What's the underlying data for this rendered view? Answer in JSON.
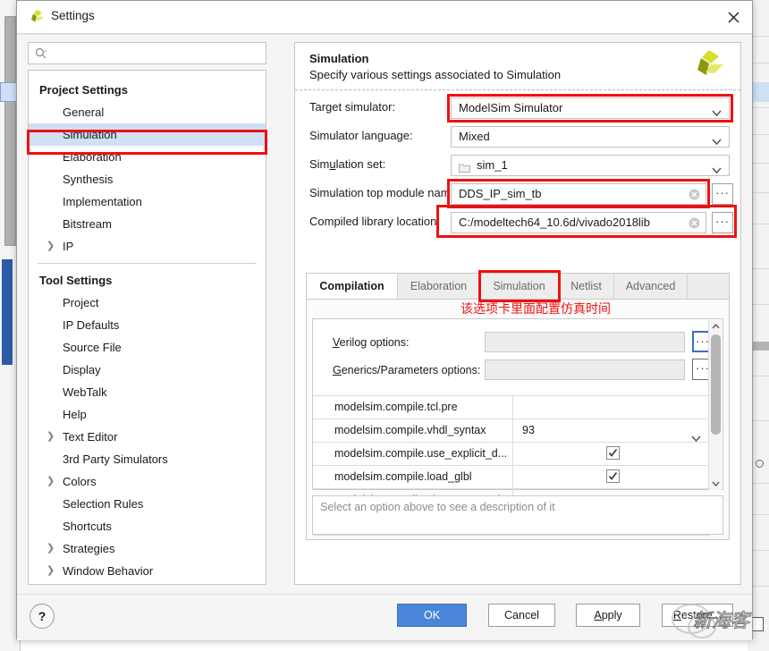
{
  "window": {
    "title": "Settings",
    "logo_icon": "vivado-logo-icon",
    "close_icon": "close-icon"
  },
  "sidebar": {
    "search": {
      "placeholder": "",
      "value": "",
      "icon": "search-icon"
    },
    "groups": [
      {
        "title": "Project Settings",
        "items": [
          {
            "label": "General",
            "expandable": false,
            "selected": false
          },
          {
            "label": "Simulation",
            "expandable": false,
            "selected": true
          },
          {
            "label": "Elaboration",
            "expandable": false,
            "selected": false
          },
          {
            "label": "Synthesis",
            "expandable": false,
            "selected": false
          },
          {
            "label": "Implementation",
            "expandable": false,
            "selected": false
          },
          {
            "label": "Bitstream",
            "expandable": false,
            "selected": false
          },
          {
            "label": "IP",
            "expandable": true,
            "selected": false
          }
        ]
      },
      {
        "title": "Tool Settings",
        "items": [
          {
            "label": "Project",
            "expandable": false,
            "selected": false
          },
          {
            "label": "IP Defaults",
            "expandable": false,
            "selected": false
          },
          {
            "label": "Source File",
            "expandable": false,
            "selected": false
          },
          {
            "label": "Display",
            "expandable": false,
            "selected": false
          },
          {
            "label": "WebTalk",
            "expandable": false,
            "selected": false
          },
          {
            "label": "Help",
            "expandable": false,
            "selected": false
          },
          {
            "label": "Text Editor",
            "expandable": true,
            "selected": false
          },
          {
            "label": "3rd Party Simulators",
            "expandable": false,
            "selected": false
          },
          {
            "label": "Colors",
            "expandable": true,
            "selected": false
          },
          {
            "label": "Selection Rules",
            "expandable": false,
            "selected": false
          },
          {
            "label": "Shortcuts",
            "expandable": false,
            "selected": false
          },
          {
            "label": "Strategies",
            "expandable": true,
            "selected": false
          },
          {
            "label": "Window Behavior",
            "expandable": true,
            "selected": false
          }
        ]
      }
    ]
  },
  "content": {
    "heading": "Simulation",
    "subheading": "Specify various settings associated to Simulation",
    "fields": [
      {
        "label": "Target simulator:",
        "value": "ModelSim Simulator",
        "kind": "combo",
        "highlighted": true
      },
      {
        "label": "Simulator language:",
        "value": "Mixed",
        "kind": "combo",
        "highlighted": false
      },
      {
        "label": "Simulation set:",
        "value": "sim_1",
        "kind": "combo-folder",
        "highlighted": false
      },
      {
        "label": "Simulation top module name:",
        "value": "DDS_IP_sim_tb",
        "kind": "text",
        "highlighted": true
      },
      {
        "label": "Compiled library location:",
        "value": "C:/modeltech64_10.6d/vivado2018lib",
        "kind": "text",
        "highlighted": true
      }
    ],
    "dots_label": "···"
  },
  "tabs": {
    "items": [
      {
        "label": "Compilation",
        "active": true,
        "highlighted": false
      },
      {
        "label": "Elaboration",
        "active": false,
        "highlighted": false
      },
      {
        "label": "Simulation",
        "active": false,
        "highlighted": true
      },
      {
        "label": "Netlist",
        "active": false,
        "highlighted": false
      },
      {
        "label": "Advanced",
        "active": false,
        "highlighted": false
      }
    ],
    "annotation": "该选项卡里面配置仿真时间"
  },
  "options_panel": {
    "inputs": [
      {
        "label": "Verilog options:",
        "label_mnemonic": "V",
        "value": "",
        "button": "···",
        "button_focused": true
      },
      {
        "label": "Generics/Parameters options:",
        "label_mnemonic": "G",
        "value": "",
        "button": "···",
        "button_focused": false
      }
    ],
    "rows": [
      {
        "key": "modelsim.compile.tcl.pre",
        "value": "",
        "type": "text"
      },
      {
        "key": "modelsim.compile.vhdl_syntax",
        "value": "93",
        "type": "combo"
      },
      {
        "key": "modelsim.compile.use_explicit_d...",
        "value": "",
        "type": "checkbox",
        "checked": true
      },
      {
        "key": "modelsim.compile.load_glbl",
        "value": "",
        "type": "checkbox",
        "checked": true
      },
      {
        "key": "modelsim.compile.vlog.more_opti...",
        "value": "",
        "type": "text"
      }
    ],
    "description": "Select an option above to see a description of it"
  },
  "footer": {
    "help_label": "?",
    "buttons": [
      {
        "label": "OK",
        "primary": true
      },
      {
        "label": "Cancel",
        "primary": false
      },
      {
        "label": "Apply",
        "primary": false,
        "mnemonic": "A"
      },
      {
        "label": "Restore...",
        "primary": false,
        "mnemonic": "R"
      }
    ]
  },
  "watermark": {
    "text": "新海客"
  },
  "colors": {
    "accent_blue": "#4a86d8",
    "selection_blue": "#cfe0f5",
    "annotation_red": "#ee1111",
    "logo_yellow": "#d6e02a",
    "logo_olive": "#8e9612"
  }
}
